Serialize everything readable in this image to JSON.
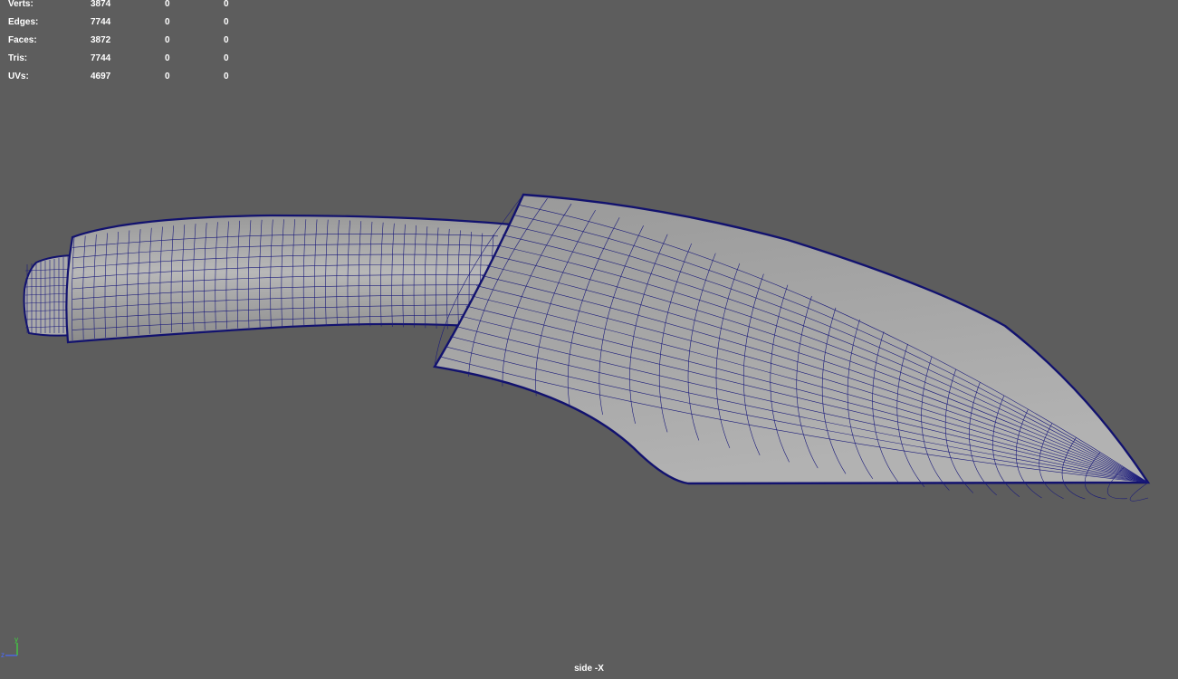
{
  "hud": {
    "rows": [
      {
        "label": "Verts:",
        "total": "3874",
        "selected": "0",
        "components": "0"
      },
      {
        "label": "Edges:",
        "total": "7744",
        "selected": "0",
        "components": "0"
      },
      {
        "label": "Faces:",
        "total": "3872",
        "selected": "0",
        "components": "0"
      },
      {
        "label": "Tris:",
        "total": "7744",
        "selected": "0",
        "components": "0"
      },
      {
        "label": "UVs:",
        "total": "4697",
        "selected": "0",
        "components": "0"
      }
    ]
  },
  "viewport": {
    "camera_label": "side -X",
    "background_color": "#5d5d5d",
    "wire_color": "#1a1a7a",
    "shade_color": "#a3a3a3"
  },
  "axis_gizmo": {
    "y_label": "y",
    "z_label": "z",
    "y_color": "#3cdc3c",
    "z_color": "#4a6aff"
  }
}
